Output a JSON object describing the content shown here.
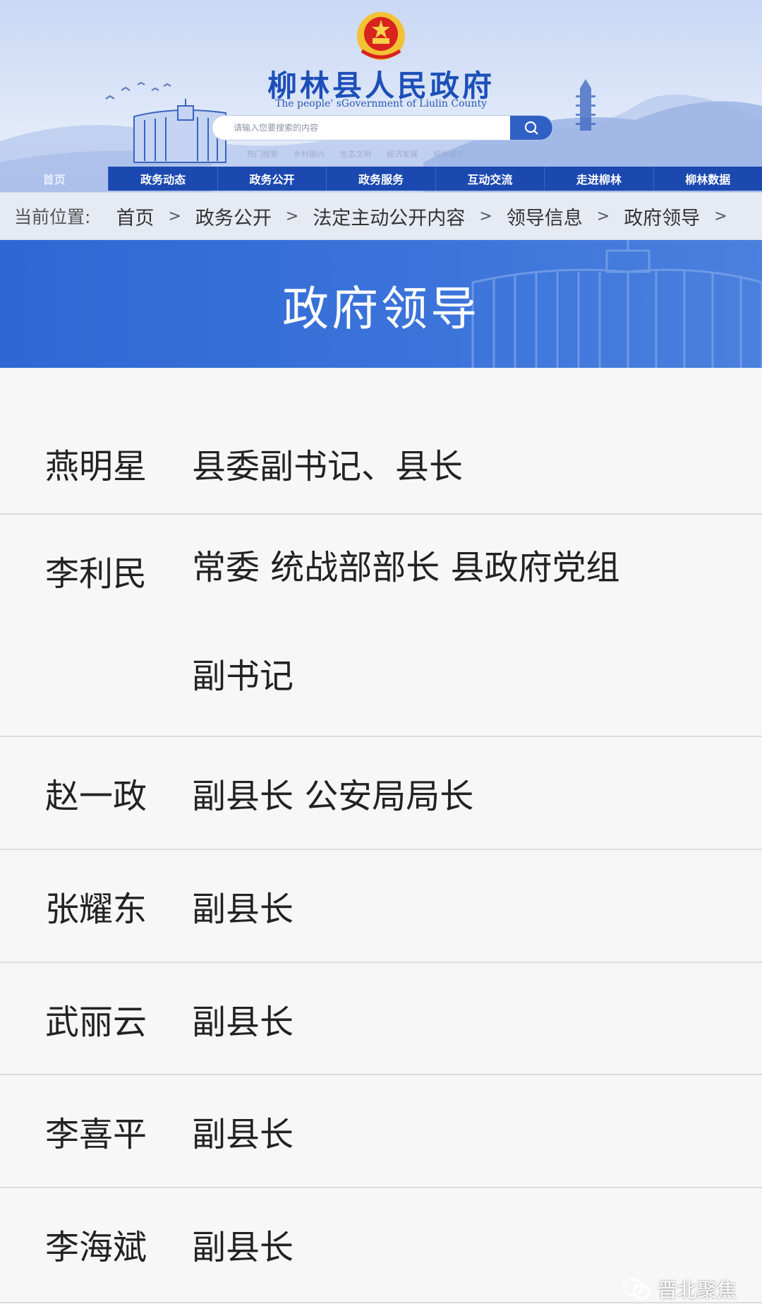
{
  "header": {
    "site_title": "柳林县人民政府",
    "site_subtitle": "The people' sGovernment of Liulin County",
    "search_placeholder": "请输入您要搜索的内容",
    "hot_links": [
      "热门搜索",
      "乡村振兴",
      "生态文明",
      "经济发展",
      "柳林城市"
    ],
    "nav": [
      "首页",
      "政务动态",
      "政务公开",
      "政务服务",
      "互动交流",
      "走进柳林",
      "柳林数据"
    ]
  },
  "breadcrumb": {
    "label": "当前位置:",
    "items": [
      "首页",
      "政务公开",
      "法定主动公开内容",
      "领导信息",
      "政府领导"
    ],
    "separator": ">"
  },
  "banner": {
    "title": "政府领导"
  },
  "leaders": [
    {
      "name": "燕明星",
      "title_lines": [
        "县委副书记、县长"
      ]
    },
    {
      "name": "李利民",
      "title_lines": [
        "常委 统战部部长 县政府党组",
        "副书记"
      ]
    },
    {
      "name": "赵一政",
      "title_lines": [
        "副县长 公安局局长"
      ]
    },
    {
      "name": "张耀东",
      "title_lines": [
        "副县长"
      ]
    },
    {
      "name": "武丽云",
      "title_lines": [
        "副县长"
      ]
    },
    {
      "name": "李喜平",
      "title_lines": [
        "副县长"
      ]
    },
    {
      "name": "李海斌",
      "title_lines": [
        "副县长"
      ]
    }
  ],
  "watermark": {
    "text": "晋北聚焦",
    "icon": "wechat-icon"
  },
  "colors": {
    "nav": "#1c49b0",
    "banner": "#3b73da",
    "title": "#1d4fb8"
  }
}
